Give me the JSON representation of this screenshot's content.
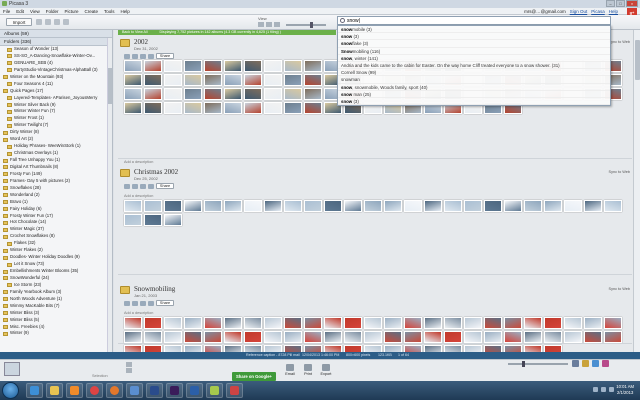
{
  "window": {
    "title": "Picasa 3"
  },
  "menu": [
    "File",
    "Edit",
    "View",
    "Folder",
    "Picture",
    "Create",
    "Tools",
    "Help"
  ],
  "account": {
    "email": "mrs@…@gmail.com",
    "sign_out": "Sign Out",
    "picasa_link": "Picasa",
    "help": "Help"
  },
  "toolbar": {
    "import_label": "Import",
    "view_label": "View"
  },
  "search": {
    "value": "snow|"
  },
  "suggestions": [
    {
      "bold": "snow",
      "rest": "mobile (3)"
    },
    {
      "bold": "snow",
      "rest": " (3)"
    },
    {
      "bold": "snow",
      "rest": "flake (3)"
    },
    {
      "bold": "Snow",
      "rest": "mobiling (116)"
    },
    {
      "bold": "snow",
      "rest": ", winter (141)"
    },
    {
      "bold": "",
      "rest": "Andria and the kids came to the cabin for Easter. On the way home Cliff treated everyone to a snow shower. (31)"
    },
    {
      "bold": "",
      "rest": "Cornell Snow (99)"
    },
    {
      "bold": "",
      "rest": "snowman"
    },
    {
      "bold": "snow",
      "rest": ", snowmobile, Woods family, sport (40)"
    },
    {
      "bold": "snow",
      "rest": " man (25)"
    },
    {
      "bold": "snow",
      "rest": " (3)"
    }
  ],
  "sidebar": {
    "albums_header": "Albums (59)",
    "folders_header": "Folders (336)",
    "items": [
      {
        "label": "Season of Wonder (13)",
        "type": "item"
      },
      {
        "label": "SS-SO_A-Dancing-Snowflake-Winter-Ov...",
        "type": "item"
      },
      {
        "label": "GENUARE_SEB (4)",
        "type": "item"
      },
      {
        "label": "PartyStudio-VintageChristmas-AlphaBall (3)",
        "type": "item"
      },
      {
        "label": "Winter on the Mountain (93)",
        "type": "group"
      },
      {
        "label": "Four Seasons 4 (11)",
        "type": "item"
      },
      {
        "label": "Quick Pages (17)",
        "type": "group"
      },
      {
        "label": "Layered-Templates- AParisen_JoyousMerry",
        "type": "item"
      },
      {
        "label": "Winter Silver Back (9)",
        "type": "item"
      },
      {
        "label": "Winter Winter Fun (7)",
        "type": "item"
      },
      {
        "label": "Winter Frost (1)",
        "type": "item"
      },
      {
        "label": "Winter Twilight (7)",
        "type": "item"
      },
      {
        "label": "Dirty Winter (8)",
        "type": "group"
      },
      {
        "label": "Word Art (2)",
        "type": "group"
      },
      {
        "label": "Holiday Phrases- WeeWinStork (1)",
        "type": "item"
      },
      {
        "label": "Christmas Overlays (1)",
        "type": "item"
      },
      {
        "label": "Fall Tree Unhappy You (1)",
        "type": "group"
      },
      {
        "label": "Digital Art Thumbnails (8)",
        "type": "group"
      },
      {
        "label": "Frosty Fun (149)",
        "type": "group"
      },
      {
        "label": "Frames- Day 5 with pictures (2)",
        "type": "group"
      },
      {
        "label": "Snowflakes (28)",
        "type": "group"
      },
      {
        "label": "Wonderland (2)",
        "type": "group"
      },
      {
        "label": "Bravo (1)",
        "type": "group"
      },
      {
        "label": "Fairy Holiday (6)",
        "type": "group"
      },
      {
        "label": "Frosty Winter Fun (17)",
        "type": "group"
      },
      {
        "label": "Hot Chocolate (14)",
        "type": "group"
      },
      {
        "label": "Winter Magic (37)",
        "type": "group"
      },
      {
        "label": "Crochet Snowflakes (8)",
        "type": "group"
      },
      {
        "label": "Flakes (32)",
        "type": "item"
      },
      {
        "label": "Winter Flakes (2)",
        "type": "group"
      },
      {
        "label": "Doodles- Winter Holiday Doodles (9)",
        "type": "group"
      },
      {
        "label": "Let it Snow (73)",
        "type": "item"
      },
      {
        "label": "Embellishments Winter Blooms (35)",
        "type": "group"
      },
      {
        "label": "SnowWonderful (24)",
        "type": "group"
      },
      {
        "label": "Ice Storm (23)",
        "type": "item"
      },
      {
        "label": "Family Yearbook Album (3)",
        "type": "group"
      },
      {
        "label": "North Woods Adventure (1)",
        "type": "group"
      },
      {
        "label": "Wimmy MacKable Bits (7)",
        "type": "group"
      },
      {
        "label": "Winter Bliss (3)",
        "type": "group"
      },
      {
        "label": "Winter Bliss (5)",
        "type": "group"
      },
      {
        "label": "Misc. Freebies (4)",
        "type": "group"
      },
      {
        "label": "Winter (9)",
        "type": "group"
      }
    ]
  },
  "main": {
    "infobar": {
      "back": "Back to View All",
      "summary": "Displaying 7,752 pictures in 142 albums (4.3 GB currently in 4,625 (1 filing) )"
    },
    "share_label": "Share",
    "add_description": "Add a description",
    "sync_label": "Sync to Web",
    "albums": [
      {
        "name": "2002",
        "date": "Dec 31, 2002",
        "thumb_count": 95
      },
      {
        "name": "Christmas 2002",
        "date": "Dec 25, 2002",
        "thumb_count": 28
      },
      {
        "name": "Snowmobiling",
        "date": "Jan 21, 2003",
        "thumb_count": 72
      }
    ]
  },
  "status": {
    "left": "Selection: 0",
    "file": "Reference caption - 8728 Pill mail",
    "date": "12/04/2013 1:46:00 PM",
    "size": "800×600 pixels",
    "bytes": "123.1KB",
    "count": "1 of 64"
  },
  "tray": {
    "selection_label": "Selection",
    "share_google": "Share on Google+",
    "email": "Email",
    "print": "Print",
    "export": "Export"
  },
  "taskbar": {
    "time": "10:01 AM",
    "date": "2/1/2013"
  },
  "colors": {
    "accent_green": "#6bb04a",
    "status_blue": "#2c5d87",
    "gplus_red": "#d23b2f"
  }
}
